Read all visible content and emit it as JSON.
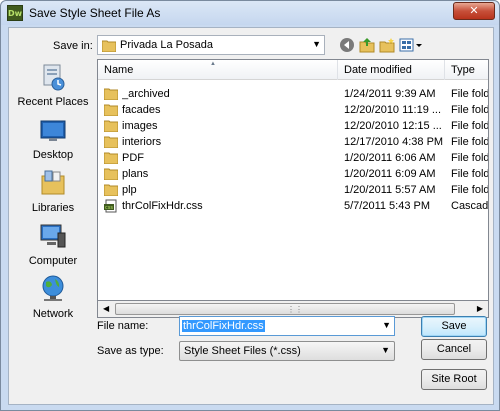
{
  "window": {
    "title": "Save Style Sheet File As",
    "app_icon_text": "Dw",
    "close_label": "✕"
  },
  "save_in": {
    "label": "Save in:",
    "value": "Privada La Posada"
  },
  "places": [
    "Recent Places",
    "Desktop",
    "Libraries",
    "Computer",
    "Network"
  ],
  "columns": {
    "name": "Name",
    "date": "Date modified",
    "type": "Type"
  },
  "files": [
    {
      "name": "_archived",
      "date": "1/24/2011 9:39 AM",
      "type": "File folder",
      "kind": "folder"
    },
    {
      "name": "facades",
      "date": "12/20/2010 11:19 ...",
      "type": "File folder",
      "kind": "folder"
    },
    {
      "name": "images",
      "date": "12/20/2010 12:15 ...",
      "type": "File folder",
      "kind": "folder"
    },
    {
      "name": "interiors",
      "date": "12/17/2010 4:38 PM",
      "type": "File folder",
      "kind": "folder"
    },
    {
      "name": "PDF",
      "date": "1/20/2011 6:06 AM",
      "type": "File folder",
      "kind": "folder"
    },
    {
      "name": "plans",
      "date": "1/20/2011 6:09 AM",
      "type": "File folder",
      "kind": "folder"
    },
    {
      "name": "plp",
      "date": "1/20/2011 5:57 AM",
      "type": "File folder",
      "kind": "folder"
    },
    {
      "name": "thrColFixHdr.css",
      "date": "5/7/2011 5:43 PM",
      "type": "Cascading",
      "kind": "css"
    }
  ],
  "file_name": {
    "label": "File name:",
    "value": "thrColFixHdr.css"
  },
  "save_as_type": {
    "label": "Save as type:",
    "value": "Style Sheet Files (*.css)"
  },
  "buttons": {
    "save": "Save",
    "cancel": "Cancel",
    "site_root": "Site Root"
  },
  "colors": {
    "folder": "#e7c15c",
    "accent": "#3399ff"
  }
}
